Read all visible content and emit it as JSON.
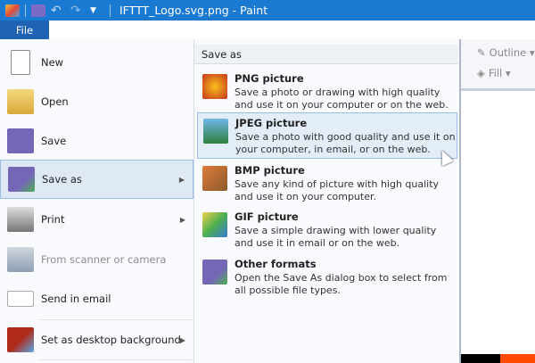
{
  "window": {
    "title": "IFTTT_Logo.svg.png - Paint"
  },
  "tabs": {
    "file": "File"
  },
  "ribbon": {
    "outline": "Outline",
    "fill": "Fill"
  },
  "file_menu": {
    "items": [
      {
        "label": "New",
        "icon": "new-file-icon"
      },
      {
        "label": "Open",
        "icon": "open-folder-icon"
      },
      {
        "label": "Save",
        "icon": "floppy-disk-icon"
      },
      {
        "label": "Save as",
        "icon": "save-as-icon"
      },
      {
        "label": "Print",
        "icon": "printer-icon"
      },
      {
        "label": "From scanner or camera",
        "icon": "scanner-icon"
      },
      {
        "label": "Send in email",
        "icon": "email-icon"
      },
      {
        "label": "Set as desktop background",
        "icon": "desktop-icon"
      }
    ]
  },
  "save_as": {
    "header": "Save as",
    "items": [
      {
        "title": "PNG picture",
        "desc": "Save a photo or drawing with high quality and use it on your computer or on the web."
      },
      {
        "title": "JPEG picture",
        "desc": "Save a photo with good quality and use it on your computer, in email, or on the web."
      },
      {
        "title": "BMP picture",
        "desc": "Save any kind of picture with high quality and use it on your computer."
      },
      {
        "title": "GIF picture",
        "desc": "Save a simple drawing with lower quality and use it in email or on the web."
      },
      {
        "title": "Other formats",
        "desc": "Open the Save As dialog box to select from all possible file types."
      }
    ]
  }
}
